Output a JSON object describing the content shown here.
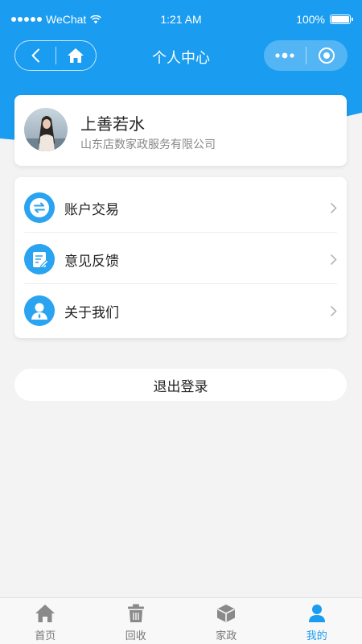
{
  "status_bar": {
    "carrier": "WeChat",
    "time": "1:21 AM",
    "battery": "100%"
  },
  "nav": {
    "title": "个人中心"
  },
  "profile": {
    "name": "上善若水",
    "organization": "山东店数家政服务有限公司"
  },
  "menu": {
    "items": [
      {
        "label": "账户交易",
        "icon": "exchange-icon"
      },
      {
        "label": "意见反馈",
        "icon": "feedback-edit-icon"
      },
      {
        "label": "关于我们",
        "icon": "person-icon"
      }
    ]
  },
  "logout": {
    "label": "退出登录"
  },
  "tabbar": {
    "items": [
      {
        "label": "首页",
        "icon": "home-icon",
        "active": false
      },
      {
        "label": "回收",
        "icon": "trash-icon",
        "active": false
      },
      {
        "label": "家政",
        "icon": "box-icon",
        "active": false
      },
      {
        "label": "我的",
        "icon": "user-icon",
        "active": true
      }
    ]
  },
  "colors": {
    "primary": "#2aa3f0",
    "header": "#1a9cf0",
    "tab_active": "#1a9cf0",
    "background": "#f3f3f3"
  }
}
